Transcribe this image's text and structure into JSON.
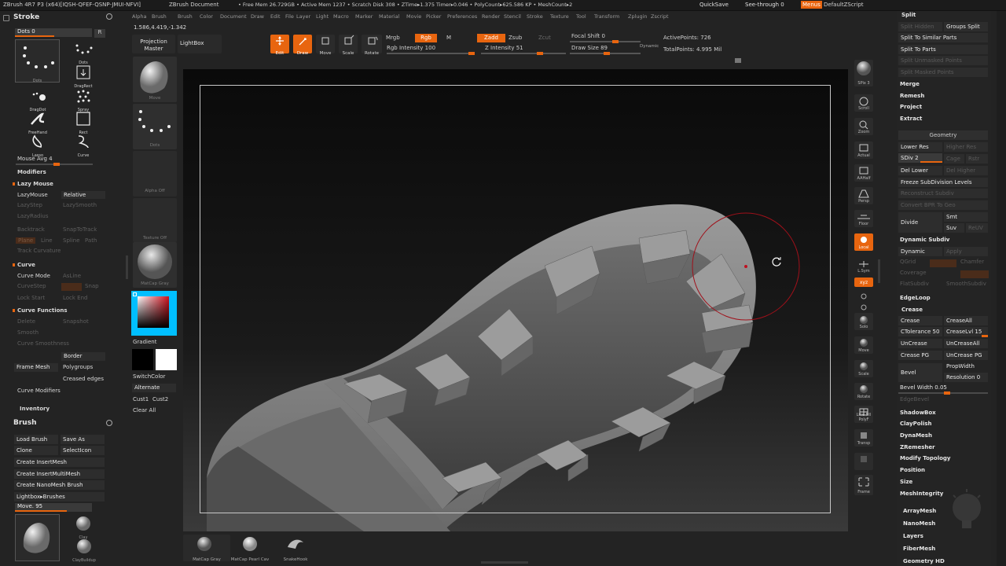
{
  "titlebar": {
    "app": "ZBrush 4R7 P3 (x64)[IQSH-QFEF-QSNP-JMUI-NFVI]",
    "doc": "ZBrush Document",
    "stats": "• Free Mem 26.729GB • Active Mem 1237 • Scratch Disk 308 • ZTime▸1.375 Timer▸0.046 • PolyCount▸625.586 KP • MeshCount▸2",
    "quicksave": "QuickSave",
    "seethrough": "See-through  0",
    "menus": "Menus",
    "script": "DefaultZScript"
  },
  "menubar": [
    "Alpha",
    "Brush",
    "Color",
    "Document",
    "Draw",
    "Edit",
    "File",
    "Layer",
    "Light",
    "Macro",
    "Marker",
    "Material",
    "Movie",
    "Picker",
    "Preferences",
    "Render",
    "Stencil",
    "Stroke",
    "Texture",
    "Tool",
    "Transform",
    "Zplugin",
    "Zscript"
  ],
  "coords": "1.586,4.419,-1.342",
  "toolbar": {
    "projection_master": "Projection Master",
    "lightbox": "LightBox",
    "edit": "Edit",
    "draw": "Draw",
    "move": "Move",
    "scale": "Scale",
    "rotate": "Rotate",
    "mrgb": "Mrgb",
    "rgb": "Rgb",
    "m": "M",
    "rgb_intensity": "Rgb Intensity 100",
    "zadd": "Zadd",
    "zsub": "Zsub",
    "zcut": "Zcut",
    "z_intensity": "Z Intensity 51",
    "focal_shift": "Focal Shift 0",
    "draw_size": "Draw Size 89",
    "dynamic": "Dynamic",
    "active_points": "ActivePoints: 726",
    "total_points": "TotalPoints: 4.995 Mil"
  },
  "left": {
    "stroke_title": "Stroke",
    "dots_slider": "Dots  0",
    "r": "R",
    "strokes": [
      {
        "label": "Dots"
      },
      {
        "label": "Dots"
      },
      {
        "label": "DragRect"
      },
      {
        "label": "DragDot"
      },
      {
        "label": "Spray"
      },
      {
        "label": "FreeHand"
      },
      {
        "label": "Rect"
      },
      {
        "label": "Lasso"
      },
      {
        "label": "Curve"
      }
    ],
    "mouse_avg": "Mouse Avg 4",
    "modifiers": "Modifiers",
    "lazy_mouse": "Lazy Mouse",
    "lazymouse": "LazyMouse",
    "relative": "Relative",
    "lazystep": "LazyStep",
    "lazysmooth": "LazySmooth",
    "lazyradius": "LazyRadius",
    "backtrack": "Backtrack",
    "snaptotrack": "SnapToTrack",
    "plane": "Plane",
    "line": "Line",
    "spline": "Spline",
    "path": "Path",
    "track_curvature": "Track Curvature",
    "curve": "Curve",
    "curve_mode": "Curve Mode",
    "as_line": "AsLine",
    "curvestep": "CurveStep",
    "snap": "Snap",
    "lock_start": "Lock Start",
    "lock_end": "Lock End",
    "curve_functions": "Curve Functions",
    "delete": "Delete",
    "snapshot": "Snapshot",
    "smooth": "Smooth",
    "curve_smoothness": "Curve Smoothness",
    "border": "Border",
    "frame_mesh": "Frame Mesh",
    "polygroups": "Polygroups",
    "creased_edges": "Creased edges",
    "curve_modifiers": "Curve Modifiers",
    "inventory": "Inventory",
    "brush_title": "Brush",
    "load_brush": "Load Brush",
    "save_as": "Save As",
    "clone": "Clone",
    "selecticon": "SelectIcon",
    "create_insertmesh": "Create InsertMesh",
    "create_insertmultimesh": "Create InsertMultiMesh",
    "create_nanomesh": "Create NanoMesh Brush",
    "lightbox_brushes": "Lightbox▸Brushes",
    "move_slider": "Move. 95",
    "brushes": [
      {
        "label": "Move"
      },
      {
        "label": "Clay"
      },
      {
        "label": "ClayBuildup"
      }
    ]
  },
  "shelf": {
    "items": [
      {
        "label": "Move"
      },
      {
        "label": "Dots"
      },
      {
        "label": "Alpha Off"
      },
      {
        "label": "Texture Off"
      },
      {
        "label": "MatCap Gray"
      }
    ],
    "gradient": "Gradient",
    "switchcolor": "SwitchColor",
    "alternate": "Alternate",
    "cust1": "Cust1",
    "cust2": "Cust2",
    "clear_all": "Clear All"
  },
  "rightshelf": [
    "SPix 3",
    "Scroll",
    "Zoom",
    "Actual",
    "AAHalf",
    "Persp",
    "Floor",
    "Local",
    "L.Sym",
    "xyz",
    "",
    "",
    "Solo",
    "Move",
    "Scale",
    "Rotate",
    "Line Fill PolyF",
    "Transp",
    "",
    "Frame"
  ],
  "rightpanel": {
    "split": "Split",
    "split_hidden": "Split Hidden",
    "groups_split": "Groups Split",
    "split_similar": "Split To Similar Parts",
    "split_parts": "Split To Parts",
    "split_unmasked": "Split Unmasked Points",
    "split_masked": "Split Masked Points",
    "merge": "Merge",
    "remesh": "Remesh",
    "project": "Project",
    "extract": "Extract",
    "geometry": "Geometry",
    "lower_res": "Lower Res",
    "higher_res": "Higher Res",
    "sdiv": "SDiv 2",
    "cage": "Cage",
    "rstr": "Rstr",
    "del_lower": "Del Lower",
    "del_higher": "Del Higher",
    "freeze_subdiv": "Freeze SubDivision Levels",
    "reconstruct": "Reconstruct Subdiv",
    "convert_bpr": "Convert BPR To Geo",
    "divide": "Divide",
    "smt": "Smt",
    "suv": "Suv",
    "reuv": "ReUV",
    "dynamic_subdiv": "Dynamic Subdiv",
    "dynamic": "Dynamic",
    "apply": "Apply",
    "qgrid": "QGrid",
    "coverage": "Coverage",
    "flatsubdiv": "FlatSubdiv",
    "smoothsubdiv": "SmoothSubdiv",
    "edgeloop": "EdgeLoop",
    "crease_hdr": "Crease",
    "crease": "Crease",
    "creaseall": "CreaseAll",
    "ctolerance": "CTolerance 50",
    "creaselvl": "CreaseLvl 15",
    "uncrease": "UnCrease",
    "uncreaseall": "UnCreaseAll",
    "crease_pg": "Crease PG",
    "uncrease_pg": "UnCrease PG",
    "bevel": "Bevel",
    "propwidth": "PropWidth",
    "resolution": "Resolution 0",
    "bevel_width": "Bevel Width 0.05",
    "edgebevel": "EdgeBevel",
    "menu": [
      "ShadowBox",
      "ClayPolish",
      "DynaMesh",
      "ZRemesher",
      "Modify Topology",
      "Position",
      "Size",
      "MeshIntegrity"
    ],
    "bottom": [
      "ArrayMesh",
      "NanoMesh",
      "Layers",
      "FiberMesh",
      "Geometry HD"
    ]
  },
  "bottomshelf": [
    {
      "label": "MatCap Gray"
    },
    {
      "label": "MatCap Pearl Cav"
    },
    {
      "label": "SnakeHook"
    }
  ]
}
